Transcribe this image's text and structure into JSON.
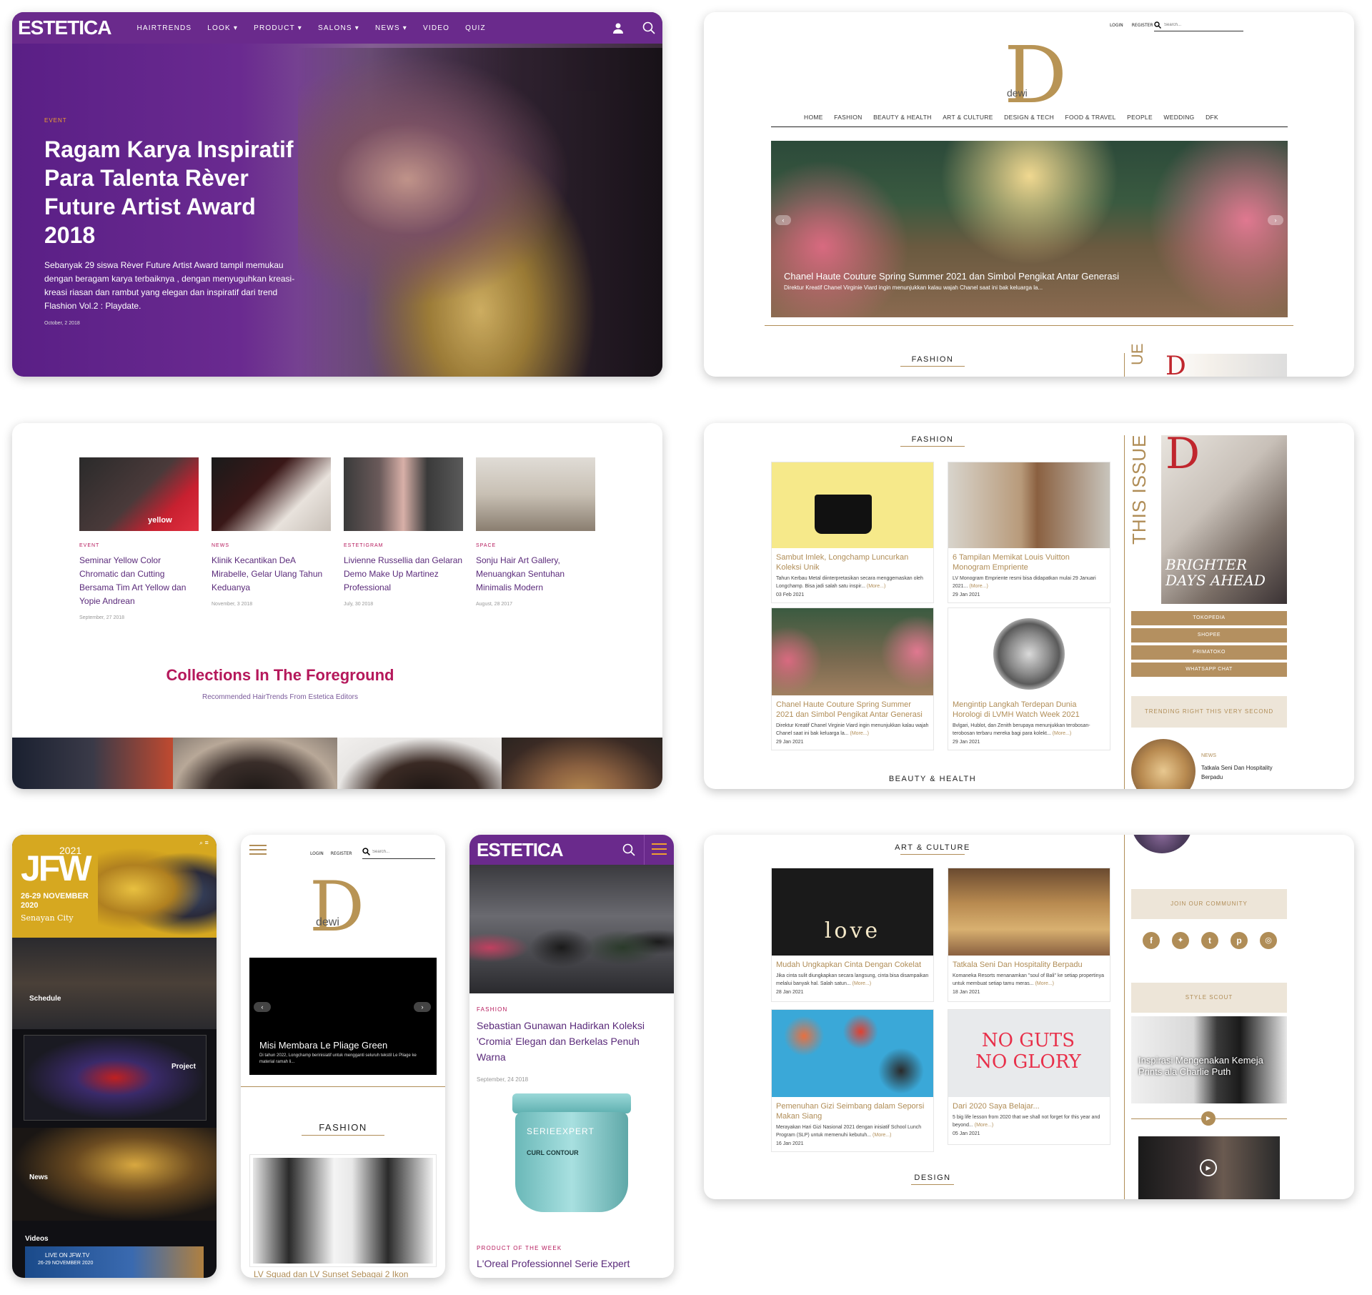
{
  "estetica_hero": {
    "logo": "ESTETICA",
    "nav": [
      "HAIRTRENDS",
      "LOOK",
      "PRODUCT",
      "SALONS",
      "NEWS",
      "VIDEO",
      "QUIZ"
    ],
    "category": "EVENT",
    "title": "Ragam Karya Inspiratif Para Talenta Rèver Future Artist Award 2018",
    "body": "Sebanyak 29 siswa Rèver Future Artist Award tampil memukau dengan beragam karya terbaiknya , dengan menyuguhkan kreasi-kreasi riasan dan rambut yang elegan dan inspiratif dari trend Flashion Vol.2 : Playdate.",
    "date": "October, 2 2018"
  },
  "dewi_home": {
    "top_links": [
      "LOGIN",
      "REGISTER"
    ],
    "search_placeholder": "Search...",
    "logo_letter": "D",
    "logo_word": "dewi",
    "nav": [
      "HOME",
      "FASHION",
      "BEAUTY & HEALTH",
      "ART & CULTURE",
      "DESIGN & TECH",
      "FOOD & TRAVEL",
      "PEOPLE",
      "WEDDING",
      "DFK"
    ],
    "slide_title": "Chanel Haute Couture Spring Summer 2021 dan Simbol Pengikat Antar Generasi",
    "slide_sub": "Direktur Kreatif Chanel Virginie Viard ingin menunjukkan kalau wajah Chanel saat ini bak keluarga la...",
    "section": "FASHION",
    "side_label": "UE"
  },
  "estetica_list": {
    "articles": [
      {
        "cat": "EVENT",
        "title": "Seminar Yellow Color Chromatic dan Cutting Bersama Tim Art Yellow dan Yopie Andrean",
        "date": "September, 27 2018"
      },
      {
        "cat": "NEWS",
        "title": "Klinik Kecantikan DeA Mirabelle, Gelar Ulang Tahun Keduanya",
        "date": "November, 3 2018"
      },
      {
        "cat": "ESTETIGRAM",
        "title": "Livienne Russellia dan Gelaran Demo Make Up Martinez Professional",
        "date": "July, 30 2018"
      },
      {
        "cat": "SPACE",
        "title": "Sonju Hair Art Gallery, Menuangkan Sentuhan Minimalis Modern",
        "date": "August, 28 2017"
      }
    ],
    "collections_title": "Collections In The Foreground",
    "collections_sub": "Recommended HairTrends From Estetica Editors"
  },
  "dewi_fashion": {
    "section": "FASHION",
    "tiles": [
      {
        "title": "Sambut Imlek, Longchamp Luncurkan Koleksi Unik",
        "text": "Tahun Kerbau Metal diinterpretasikan secara menggemaskan oleh Longchamp. Bisa jadi salah satu inspir...",
        "more": "(More...)",
        "date": "03 Feb 2021"
      },
      {
        "title": "6 Tampilan Memikat Louis Vuitton Monogram Empriente",
        "text": "LV Monogram Empriente resmi bisa didapatkan mulai 29 Januari 2021...",
        "more": "(More...)",
        "date": "29 Jan 2021"
      },
      {
        "title": "Chanel Haute Couture Spring Summer 2021 dan Simbol Pengikat Antar Generasi",
        "text": "Direktur Kreatif Chanel Virginie Viard ingin menunjukkan kalau wajah Chanel saat ini bak keluarga la...",
        "more": "(More...)",
        "date": "29 Jan 2021"
      },
      {
        "title": "Mengintip Langkah Terdepan Dunia Horologi di LVMH Watch Week 2021",
        "text": "Bvlgari, Hublot, dan Zenith berupaya menunjukkan terobosan-terobosan terbaru mereka bagi para kolekt...",
        "more": "(More...)",
        "date": "29 Jan 2021"
      }
    ],
    "this_issue": "THIS ISSUE",
    "cover_headline": "BRIGHTER DAYS AHEAD",
    "shops": [
      "TOKOPEDIA",
      "SHOPEE",
      "PRIMATOKO",
      "WHATSAPP CHAT"
    ],
    "trending": "TRENDING RIGHT THIS VERY SECOND",
    "trend_item": {
      "cat": "NEWS",
      "title": "Tatkala Seni Dan Hospitality Berpadu"
    },
    "next_section": "BEAUTY & HEALTH"
  },
  "jfw_mobile": {
    "year": "2021",
    "logo": "JFW",
    "dates": "26-29 NOVEMBER 2020",
    "venue": "Senayan City",
    "labels": [
      "Schedule",
      "Project",
      "News",
      "Videos"
    ],
    "live": "LIVE ON JFW.TV",
    "live_dates": "26-29 NOVEMBER 2020"
  },
  "dewi_mobile": {
    "top_links": [
      "LOGIN",
      "REGISTER"
    ],
    "search_placeholder": "Search...",
    "logo_letter": "D",
    "logo_word": "dewi",
    "slide_title": "Misi Membara Le Pliage Green",
    "slide_sub": "Di tahun 2022, Longchamp berinisiatif untuk mengganti seluruh tekstil Le Pliage ke material ramah li...",
    "section": "FASHION",
    "article": "LV Squad dan LV Sunset Sebagai 2 Ikon"
  },
  "estetica_mobile": {
    "logo": "ESTETICA",
    "cat": "FASHION",
    "title": "Sebastian Gunawan Hadirkan Koleksi 'Cromia' Elegan dan Berkelas Penuh Warna",
    "date": "September, 24 2018",
    "product_label": "PRODUCT OF THE WEEK",
    "product_title": "L'Oreal Professionnel Serie Expert",
    "jar_brand": "SERIEEXPERT",
    "jar_line": "CURL CONTOUR"
  },
  "dewi_art": {
    "section": "ART & CULTURE",
    "tiles": [
      {
        "title": "Mudah Ungkapkan Cinta Dengan Cokelat",
        "text": "Jika cinta sulit diungkapkan secara langsung, cinta bisa disampaikan melalui banyak hal. Salah satun...",
        "more": "(More...)",
        "date": "28 Jan 2021",
        "img_text": "love"
      },
      {
        "title": "Tatkala Seni Dan Hospitality Berpadu",
        "text": "Komaneka Resorts menanamkan \"soul of Bali\" ke setiap propertinya untuk membuat setiap tamu meras...",
        "more": "(More...)",
        "date": "18 Jan 2021"
      },
      {
        "title": "Pemenuhan Gizi Seimbang dalam Seporsi Makan Siang",
        "text": "Merayakan Hari Gizi Nasional 2021 dengan inisiatif School Lunch Program (SLP) untuk memenuhi kebutuh...",
        "more": "(More...)",
        "date": "16 Jan 2021"
      },
      {
        "title": "Dari 2020 Saya Belajar...",
        "text": "5 big life lesson from 2020 that we shall not forget for this year and beyond...",
        "more": "(More...)",
        "date": "05 Jan 2021",
        "img_text": "NO GUTS NO GLORY"
      }
    ],
    "community": "JOIN OUR COMMUNITY",
    "socials": [
      "facebook-icon",
      "twitter-icon",
      "tumblr-icon",
      "pinterest-icon",
      "instagram-icon"
    ],
    "style_scout": "STYLE SCOUT",
    "scout_caption": "Inspirasi Mengenakan Kemeja Prints ala Charlie Puth",
    "next_section": "DESIGN"
  },
  "colors": {
    "estetica_purple": "#6a2a8c",
    "dewi_gold": "#b08d57",
    "magenta": "#b5185b",
    "jfw_yellow": "#d6a820"
  }
}
